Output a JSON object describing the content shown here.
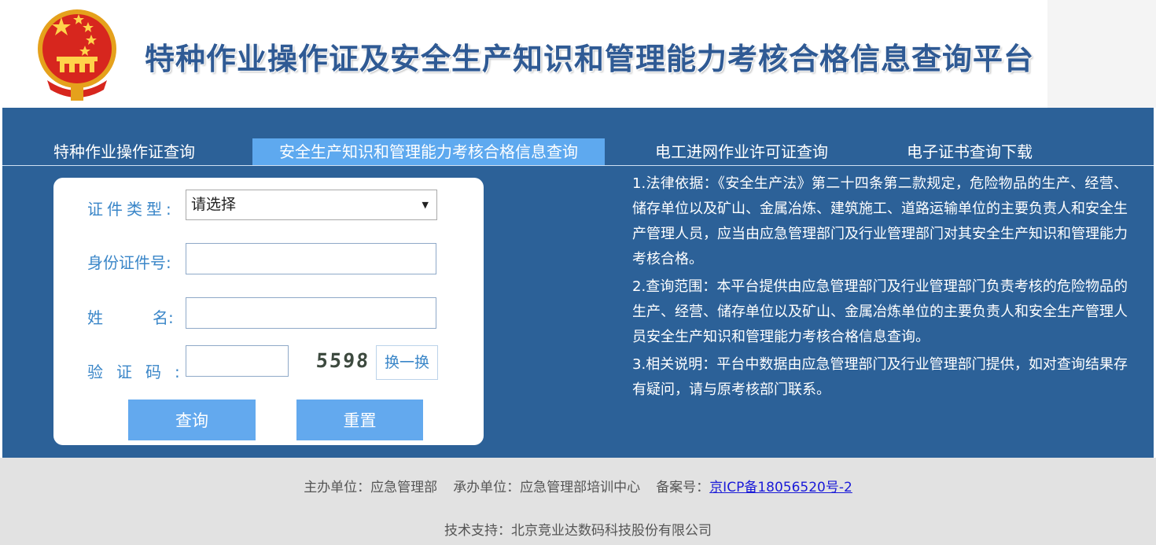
{
  "header": {
    "title": "特种作业操作证及安全生产知识和管理能力考核合格信息查询平台",
    "emblem_icon": "national-emblem-icon"
  },
  "colors": {
    "band": "#2c6198",
    "tab_active": "#5ea9ef",
    "button": "#63a9ee",
    "label": "#3a86c8",
    "title": "#2f5a94",
    "footer_bg": "#e2e2e2"
  },
  "nav": {
    "tabs": [
      {
        "label": "特种作业操作证查询"
      },
      {
        "label": "安全生产知识和管理能力考核合格信息查询",
        "active": true
      },
      {
        "label": "电工进网作业许可证查询"
      },
      {
        "label": "电子证书查询下载"
      }
    ]
  },
  "form": {
    "cert_type_label": "证件类型:",
    "cert_type_value": "请选择",
    "id_label": "身份证件号:",
    "id_value": "",
    "name_label_1": "姓",
    "name_label_2": "名:",
    "name_value": "",
    "captcha_label": "验证码:",
    "captcha_value": "",
    "captcha_text": "5598",
    "refresh_label": "换一换",
    "query_label": "查询",
    "reset_label": "重置"
  },
  "info": {
    "p1": "1.法律依据：《安全生产法》第二十四条第二款规定，危险物品的生产、经营、储存单位以及矿山、金属冶炼、建筑施工、道路运输单位的主要负责人和安全生产管理人员，应当由应急管理部门及行业管理部门对其安全生产知识和管理能力考核合格。",
    "p2": "2.查询范围：本平台提供由应急管理部门及行业管理部门负责考核的危险物品的生产、经营、储存单位以及矿山、金属冶炼单位的主要负责人和安全生产管理人员安全生产知识和管理能力考核合格信息查询。",
    "p3": "3.相关说明：平台中数据由应急管理部门及行业管理部门提供，如对查询结果存有疑问，请与原考核部门联系。"
  },
  "footer": {
    "host": "主办单位：应急管理部",
    "organizer": "承办单位：应急管理部培训中心",
    "record_label": "备案号：",
    "icp": "京ICP备18056520号-2",
    "support": "技术支持：北京竞业达数码科技股份有限公司"
  }
}
